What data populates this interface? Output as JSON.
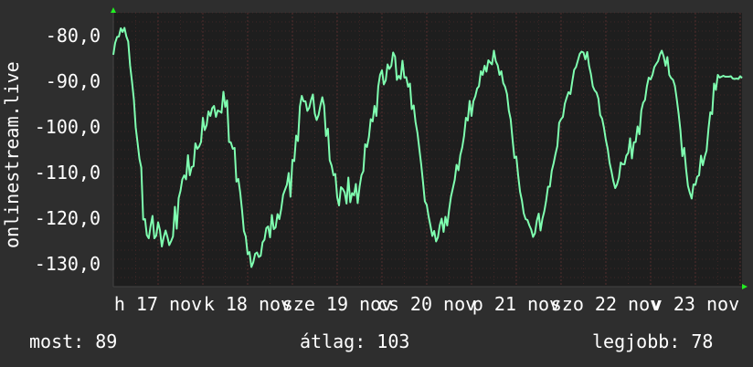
{
  "chart_data": {
    "type": "line",
    "title": "",
    "ylabel": "onlinestream.live",
    "xlabel": "",
    "ylim": [
      -135,
      -75
    ],
    "yticks": [
      -80,
      -90,
      -100,
      -110,
      -120,
      -130
    ],
    "ytick_labels": [
      "-80,0",
      "-90,0",
      "-100,0",
      "-110,0",
      "-120,0",
      "-130,0"
    ],
    "xtick_labels": [
      "h 17 nov",
      "k 18 nov",
      "sze 19 nov",
      "cs 20 nov",
      "p 21 nov",
      "szo 22 nov",
      "v 23 nov"
    ],
    "grid": true,
    "line_color": "#7fffb0",
    "x": [
      0.0,
      0.5,
      1.0,
      1.5,
      2.0,
      2.5,
      3.0,
      3.5,
      4.0,
      4.5,
      5.0,
      5.5,
      6.0,
      6.5,
      7.0,
      7.5,
      8.0,
      8.5,
      9.0,
      9.5,
      10.0,
      10.5,
      11.0,
      11.5,
      12.0,
      12.5,
      13.0,
      13.5,
      14.0,
      14.5,
      15.0,
      15.5,
      16.0,
      16.5,
      17.0,
      17.5,
      18.0,
      18.5,
      19.0,
      19.5,
      20.0,
      20.5,
      21.0,
      21.5,
      22.0,
      22.5,
      23.0,
      23.5,
      24.0,
      24.5,
      25.0,
      25.5,
      26.0,
      26.5,
      27.0,
      27.5,
      28.0,
      28.5,
      29.0,
      29.5,
      30.0,
      30.5,
      31.0,
      31.5,
      32.0,
      32.5,
      33.0,
      33.5,
      34.0,
      34.5,
      35.0,
      35.5,
      36.0,
      36.5,
      37.0,
      37.5,
      38.0,
      38.5,
      39.0,
      39.5,
      40.0,
      40.5,
      41.0,
      41.5,
      42.0,
      42.5,
      43.0,
      43.5,
      44.0,
      44.5,
      45.0,
      45.5,
      46.0,
      46.5,
      47.0,
      47.5,
      48.0,
      48.5,
      49.0,
      49.5,
      50.0,
      50.5,
      51.0,
      51.5,
      52.0,
      52.5,
      53.0,
      53.5,
      54.0,
      54.5,
      55.0,
      55.5,
      56.0,
      56.5,
      57.0,
      57.5,
      58.0,
      58.5,
      59.0,
      59.5,
      60.0,
      60.5,
      61.0,
      61.5,
      62.0,
      62.5,
      63.0,
      63.5,
      64.0,
      64.5,
      65.0,
      65.5,
      66.0,
      66.5,
      67.0,
      67.5,
      68.0,
      68.5,
      69.0,
      69.5,
      70.0,
      70.5,
      71.0,
      71.5,
      72.0,
      72.5,
      73.0,
      73.5,
      74.0,
      74.5,
      75.0,
      75.5,
      76.0,
      76.5,
      77.0,
      77.5,
      78.0,
      78.5,
      79.0,
      79.5,
      80.0,
      80.5,
      81.0,
      81.5,
      82.0,
      82.5,
      83.0,
      83.5,
      84.0,
      84.5,
      85.0,
      85.5,
      86.0,
      86.5,
      87.0,
      87.5,
      88.0,
      88.5,
      89.0,
      89.5,
      90.0,
      90.5,
      91.0,
      91.5,
      92.0,
      92.5,
      93.0,
      93.5,
      94.0,
      94.5,
      95.0,
      95.5,
      96.0,
      96.5,
      97.0,
      97.5,
      98.0,
      98.5,
      99.0,
      99.5,
      100.0,
      100.5,
      101.0,
      101.5,
      102.0,
      102.5,
      103.0,
      103.5,
      104.0,
      104.5,
      105.0,
      105.5,
      106.0,
      106.5,
      107.0,
      107.5,
      108.0,
      108.5,
      109.0,
      109.5,
      110.0,
      110.5,
      111.0,
      111.5,
      112.0,
      112.5,
      113.0,
      113.5,
      114.0,
      114.5,
      115.0,
      115.5,
      116.0,
      116.5,
      117.0,
      117.5,
      118.0,
      118.5,
      119.0,
      119.5,
      120.0,
      120.5,
      121.0,
      121.5,
      122.0,
      122.5,
      123.0,
      123.5,
      124.0,
      124.5,
      125.0,
      125.5,
      126.0,
      126.5,
      127.0,
      127.5,
      128.0,
      128.5,
      129.0,
      129.5,
      130.0,
      130.5,
      131.0,
      131.5,
      132.0,
      132.5,
      133.0,
      133.5,
      134.0,
      134.5,
      135.0,
      135.5,
      136.0,
      136.5,
      137.0,
      137.5,
      138.0,
      138.5,
      139.0,
      139.5,
      140.0,
      140.5,
      141.0,
      141.5,
      142.0,
      142.5,
      143.0,
      143.5,
      144.0,
      144.5,
      145.0,
      145.5,
      146.0,
      146.5,
      147.0,
      147.5,
      148.0,
      148.5,
      149.0,
      149.5,
      150.0,
      150.5,
      151.0,
      151.5,
      152.0,
      152.5,
      153.0,
      153.5,
      154.0,
      154.5,
      155.0,
      155.5,
      156.0,
      156.5,
      157.0,
      157.5,
      158.0,
      158.5,
      159.0,
      159.5,
      160.0,
      160.5,
      161.0,
      161.5,
      162.0,
      162.5,
      163.0,
      163.5,
      164.0,
      164.5,
      165.0,
      165.5,
      166.0,
      166.5,
      167.0,
      167.5,
      168.0,
      168.5
    ],
    "series": [
      {
        "values": [
          -84.2,
          -81.6,
          -80.3,
          -80.2,
          -78.4,
          -79.2,
          -78.3,
          -80.2,
          -81.3,
          -86.6,
          -90.0,
          -94.0,
          -100.1,
          -103.4,
          -107.0,
          -108.9,
          -120.3,
          -120.2,
          -123.7,
          -124.4,
          -121.7,
          -119.5,
          -124.4,
          -123.8,
          -120.9,
          -122.6,
          -126.2,
          -124.2,
          -122.7,
          -124.1,
          -125.9,
          -125.0,
          -124.0,
          -117.5,
          -122.3,
          -115.6,
          -114.0,
          -111.5,
          -110.6,
          -111.5,
          -106.2,
          -110.6,
          -108.8,
          -108.6,
          -103.6,
          -104.8,
          -104.3,
          -103.3,
          -98.0,
          -100.7,
          -99.6,
          -96.6,
          -97.6,
          -95.9,
          -95.4,
          -97.8,
          -96.4,
          -96.6,
          -96.9,
          -92.3,
          -95.6,
          -94.2,
          -103.3,
          -103.4,
          -104.8,
          -104.6,
          -112.0,
          -111.4,
          -114.3,
          -118.3,
          -122.8,
          -124.0,
          -127.9,
          -127.4,
          -130.7,
          -129.7,
          -127.8,
          -127.5,
          -128.5,
          -128.2,
          -125.3,
          -124.7,
          -122.2,
          -121.8,
          -124.2,
          -119.3,
          -122.4,
          -122.0,
          -119.1,
          -120.2,
          -118.0,
          -114.9,
          -113.8,
          -112.7,
          -110.1,
          -115.3,
          -107.2,
          -107.5,
          -101.9,
          -103.1,
          -95.5,
          -93.2,
          -94.4,
          -94.4,
          -96.5,
          -95.8,
          -94.1,
          -92.9,
          -97.1,
          -98.5,
          -97.4,
          -95.3,
          -93.5,
          -95.4,
          -102.0,
          -100.4,
          -107.3,
          -108.5,
          -110.6,
          -110.3,
          -115.4,
          -117.2,
          -113.2,
          -113.6,
          -114.4,
          -116.8,
          -111.1,
          -116.5,
          -114.5,
          -115.0,
          -112.5,
          -116.7,
          -113.1,
          -110.6,
          -109.7,
          -103.8,
          -104.4,
          -102.2,
          -98.3,
          -98.8,
          -95.4,
          -97.6,
          -91.2,
          -88.6,
          -87.6,
          -90.7,
          -89.8,
          -86.3,
          -87.3,
          -86.6,
          -83.7,
          -84.6,
          -89.7,
          -88.8,
          -89.5,
          -85.5,
          -89.2,
          -89.1,
          -91.2,
          -90.5,
          -96.1,
          -95.3,
          -98.9,
          -101.3,
          -104.7,
          -108.2,
          -112.1,
          -116.3,
          -117.1,
          -119.6,
          -121.7,
          -123.9,
          -122.8,
          -125.1,
          -124.2,
          -121.5,
          -120.1,
          -123.0,
          -119.7,
          -121.6,
          -118.1,
          -115.3,
          -113.4,
          -111.6,
          -108.3,
          -109.5,
          -106.2,
          -104.5,
          -102.0,
          -98.0,
          -98.6,
          -94.3,
          -97.6,
          -94.4,
          -93.3,
          -91.6,
          -91.1,
          -87.8,
          -88.6,
          -86.6,
          -87.9,
          -85.4,
          -85.9,
          -86.3,
          -83.3,
          -85.6,
          -86.5,
          -88.6,
          -87.8,
          -90.4,
          -91.2,
          -92.8,
          -96.4,
          -98.3,
          -102.8,
          -106.8,
          -106.5,
          -110.6,
          -114.2,
          -116.1,
          -118.9,
          -120.2,
          -120.4,
          -121.6,
          -122.5,
          -124.1,
          -123.3,
          -120.6,
          -119.0,
          -122.7,
          -120.1,
          -118.5,
          -116.2,
          -113.1,
          -113.1,
          -109.6,
          -108.0,
          -106.0,
          -104.2,
          -99.1,
          -98.3,
          -97.8,
          -94.9,
          -93.6,
          -92.4,
          -92.8,
          -90.1,
          -87.5,
          -86.9,
          -85.5,
          -84.0,
          -83.5,
          -83.7,
          -85.2,
          -83.6,
          -86.6,
          -88.4,
          -91.1,
          -92.0,
          -92.5,
          -93.8,
          -97.4,
          -98.2,
          -100.2,
          -102.9,
          -104.8,
          -107.9,
          -109.7,
          -111.8,
          -113.4,
          -112.6,
          -111.1,
          -107.8,
          -108.2,
          -108.2,
          -106.3,
          -105.7,
          -102.5,
          -106.9,
          -103.4,
          -103.3,
          -99.9,
          -101.6,
          -96.4,
          -94.7,
          -94.1,
          -91.1,
          -89.2,
          -89.6,
          -88.6,
          -86.9,
          -86.2,
          -85.6,
          -84.1,
          -83.3,
          -84.6,
          -86.6,
          -84.7,
          -88.6,
          -89.3,
          -89.7,
          -91.0,
          -93.8,
          -97.1,
          -100.8,
          -106.4,
          -104.6,
          -109.3,
          -112.9,
          -114.4,
          -115.7,
          -112.6,
          -112.7,
          -110.9,
          -110.6,
          -106.3,
          -108.4,
          -106.5,
          -105.2,
          -100.4,
          -96.8,
          -97.2,
          -90.5,
          -91.9,
          -88.6,
          -89.2,
          -89.0,
          -88.8,
          -89.0,
          -89.0,
          -89.0,
          -88.9,
          -89.4,
          -89.5,
          -89.4,
          -89.5,
          -88.9,
          -89.3
        ]
      }
    ]
  },
  "stats": {
    "now": "most: 89",
    "avg": "átlag: 103",
    "best": "legjobb: 78"
  },
  "colors": {
    "background": "#2e2e2e",
    "plot_background": "#1e1e1e",
    "grid": "#5a2f2f",
    "line": "#7fffb0",
    "axis_arrow": "#22ee22",
    "text": "#ffffff"
  }
}
